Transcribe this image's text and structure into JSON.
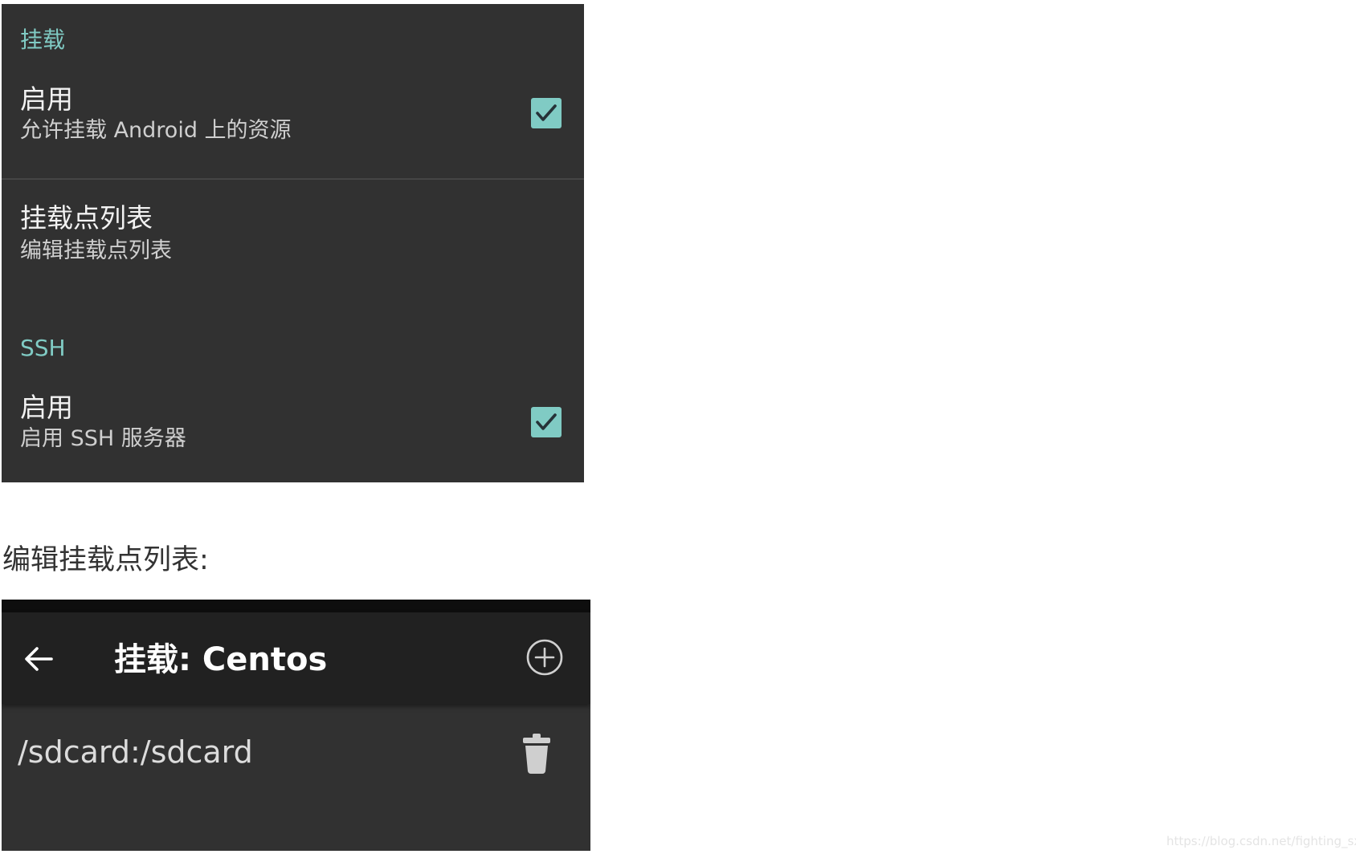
{
  "settings": {
    "mount_category": "挂载",
    "mount_enable": {
      "title": "启用",
      "summary": "允许挂载 Android 上的资源",
      "checked": true
    },
    "mount_points": {
      "title": "挂载点列表",
      "summary": "编辑挂载点列表"
    },
    "ssh_category": "SSH",
    "ssh_enable": {
      "title": "启用",
      "summary": "启用 SSH 服务器",
      "checked": true
    },
    "accent_color": "#80cbc4",
    "background_color": "#313131"
  },
  "caption": "编辑挂载点列表:",
  "mount_screen": {
    "toolbar": {
      "back_icon": "arrow-back-icon",
      "title": "挂载: Centos",
      "add_icon": "add-circle-icon"
    },
    "items": [
      {
        "path": "/sdcard:/sdcard",
        "delete_icon": "trash-icon"
      }
    ],
    "toolbar_color": "#212121"
  },
  "watermark": "https://blog.csdn.net/fighting_sxw"
}
